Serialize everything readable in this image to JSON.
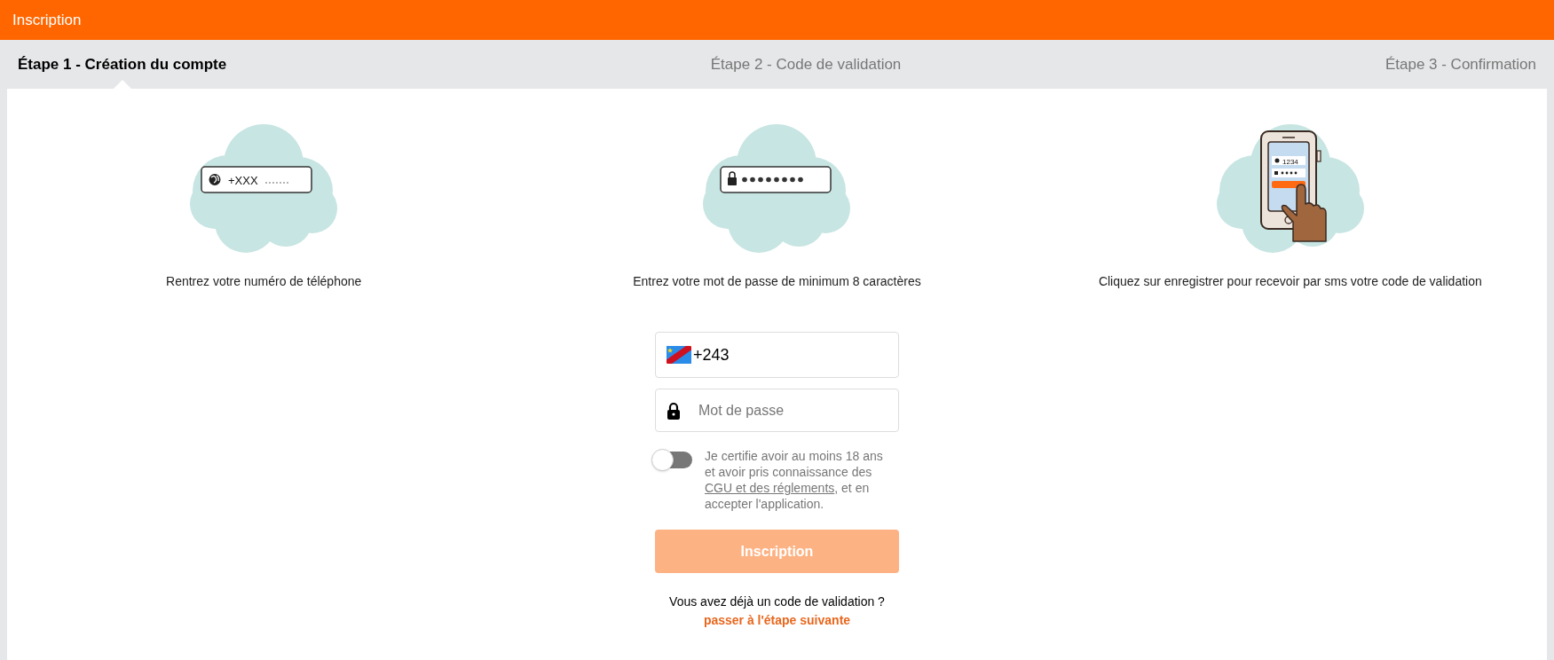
{
  "header": {
    "title": "Inscription"
  },
  "steps": [
    {
      "label": "Étape 1 - Création du compte",
      "selected": true
    },
    {
      "label": "Étape 2 - Code de validation",
      "selected": false
    },
    {
      "label": "Étape 3 - Confirmation",
      "selected": false
    }
  ],
  "illustrations": [
    {
      "kind": "phone",
      "field_text": "+XXX",
      "caption": "Rentrez votre numéro de téléphone"
    },
    {
      "kind": "password",
      "caption": "Entrez votre mot de passe de minimum 8 caractères"
    },
    {
      "kind": "sms",
      "screen_code": "1234",
      "caption": "Cliquez sur enregistrer pour recevoir par sms votre code de validation"
    }
  ],
  "form": {
    "phone": {
      "value": "+243"
    },
    "password": {
      "placeholder": "Mot de passe"
    },
    "consent": {
      "on": false,
      "text_before": "Je certifie avoir au moins 18 ans et avoir pris connaissance des",
      "link": "CGU et des réglements",
      "text_after": ", et en accepter l'application."
    },
    "submit": {
      "label": "Inscription",
      "disabled": true
    },
    "footer": {
      "question": "Vous avez déjà un code de validation ?",
      "link": "passer à l'étape suivante"
    }
  }
}
